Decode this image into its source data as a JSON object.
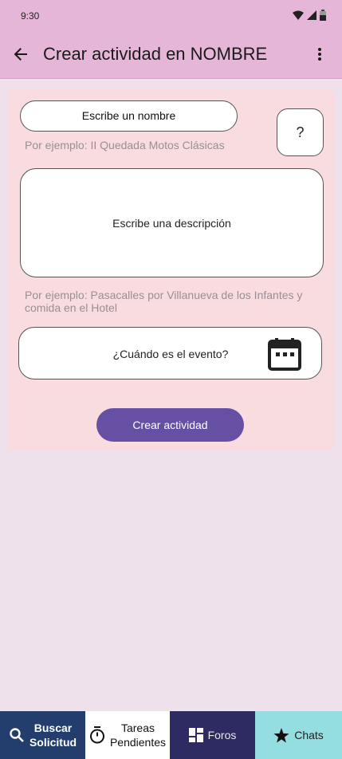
{
  "status_bar": {
    "time": "9:30"
  },
  "app_bar": {
    "title": "Crear actividad en NOMBRE"
  },
  "form": {
    "name_placeholder": "Escribe un nombre",
    "help_label": "?",
    "name_hint": "Por ejemplo: II Quedada Motos Clásicas",
    "description_placeholder": "Escribe una descripción",
    "description_hint": "Por ejemplo: Pasacalles por Villanueva de los Infantes y comida en el Hotel",
    "date_label": "¿Cuándo es el evento?",
    "submit_label": "Crear actividad"
  },
  "bottom_nav": {
    "buscar_line1": "Buscar",
    "buscar_line2": "Solicitud",
    "tareas_line1": "Tareas",
    "tareas_line2": "Pendientes",
    "foros": "Foros",
    "chats": "Chats"
  },
  "colors": {
    "app_bar": "#e6b6d8",
    "card": "#f8dcdf",
    "primary_button": "#6650a4",
    "nav_buscar": "#233e6c",
    "nav_foros": "#2e2a62",
    "nav_chats": "#94dde0"
  },
  "icons": [
    "wifi-icon",
    "signal-icon",
    "battery-icon",
    "back-arrow-icon",
    "more-vert-icon",
    "calendar-icon",
    "search-icon",
    "timer-icon",
    "dashboard-icon",
    "star-icon"
  ]
}
